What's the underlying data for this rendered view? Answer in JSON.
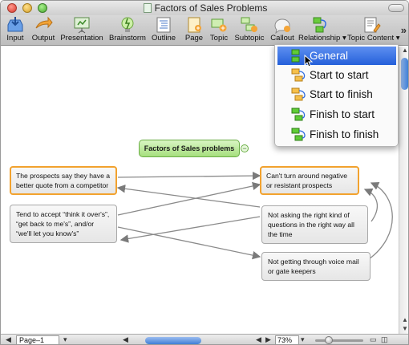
{
  "window": {
    "title": "Factors of Sales Problems"
  },
  "toolbar": {
    "items": [
      {
        "label": "Input",
        "icon": "input-icon"
      },
      {
        "label": "Output",
        "icon": "output-icon"
      },
      {
        "label": "Presentation",
        "icon": "presentation-icon"
      },
      {
        "label": "Brainstorm",
        "icon": "brainstorm-icon"
      },
      {
        "label": "Outline",
        "icon": "outline-icon"
      },
      {
        "label": "Page",
        "icon": "page-icon"
      },
      {
        "label": "Topic",
        "icon": "topic-icon"
      },
      {
        "label": "Subtopic",
        "icon": "subtopic-icon"
      },
      {
        "label": "Callout",
        "icon": "callout-icon"
      },
      {
        "label": "Relationship",
        "icon": "relationship-icon"
      },
      {
        "label": "Topic Content",
        "icon": "topic-content-icon"
      }
    ],
    "more": "»"
  },
  "relationship_menu": {
    "items": [
      {
        "label": "General",
        "highlighted": true
      },
      {
        "label": "Start to start",
        "highlighted": false
      },
      {
        "label": "Start to finish",
        "highlighted": false
      },
      {
        "label": "Finish to start",
        "highlighted": false
      },
      {
        "label": "Finish to finish",
        "highlighted": false
      }
    ]
  },
  "map": {
    "central": "Factors of Sales problems",
    "collapse": "−",
    "left_topics": [
      "The prospects say they have a better quote from a competitor",
      "Tend to accept “think it over's”, “get back to me's”, and/or “we'll let you know's”"
    ],
    "right_topics": [
      "Can't turn around negative or resistant prospects",
      "Not asking the right kind of questions in the right way all the time",
      "Not getting through voice mail or gate keepers"
    ]
  },
  "statusbar": {
    "page": "Page–1 (1/1)",
    "zoom": "73%"
  },
  "colors": {
    "highlight": "#2f6ce0",
    "selected_border": "#f2a22e",
    "central_fill": "#a6df7e"
  }
}
